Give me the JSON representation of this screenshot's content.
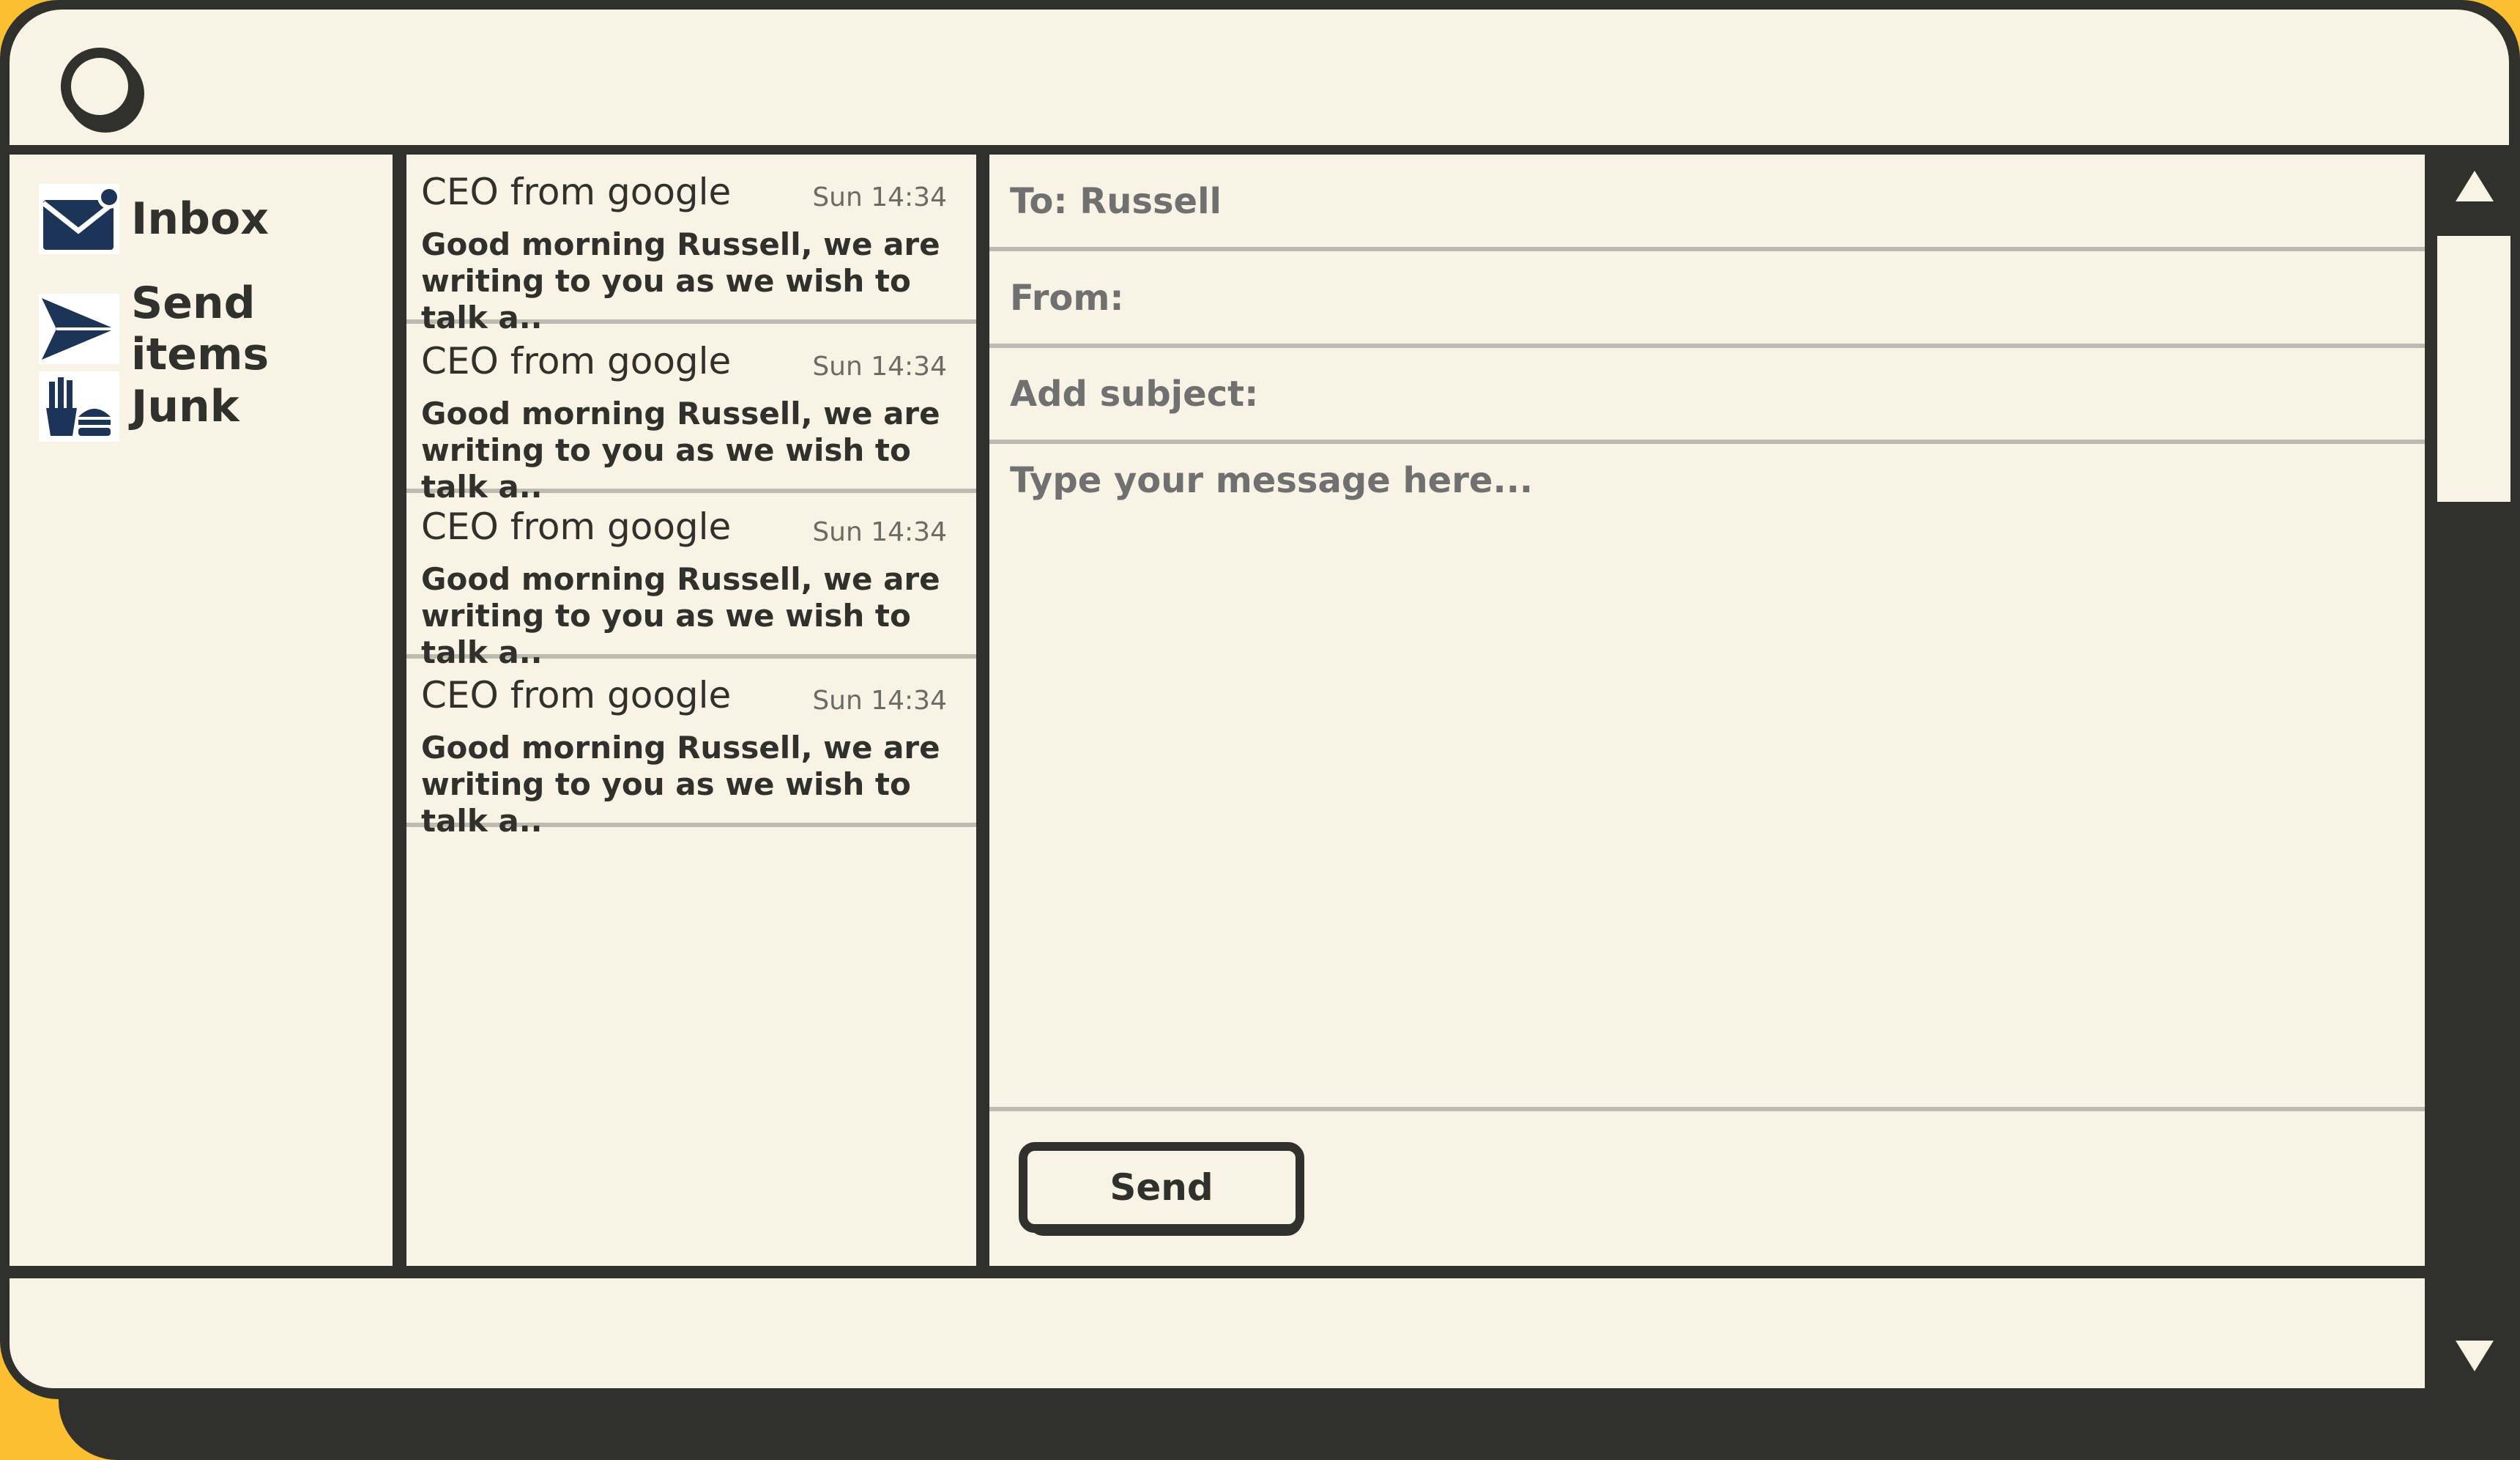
{
  "colors": {
    "accent_yellow": "#fcbf2f",
    "frame_dark": "#30302c",
    "panel_cream": "#f9f3e5",
    "icon_navy": "#1c3457",
    "divider_grey": "#bdbbb1",
    "muted_text": "#707070"
  },
  "header": {
    "logo_icon": "circle-logo-icon"
  },
  "sidebar": {
    "items": [
      {
        "label": "Inbox",
        "icon": "envelope-notification-icon"
      },
      {
        "label": "Send items",
        "icon": "paper-plane-icon"
      },
      {
        "label": "Junk",
        "icon": "junk-food-icon"
      }
    ]
  },
  "messages": [
    {
      "sender": "CEO from google",
      "time": "Sun 14:34",
      "preview_line1": "Good morning Russell, we are",
      "preview_line2": "writing to you as we wish to talk a.."
    },
    {
      "sender": "CEO from google",
      "time": "Sun 14:34",
      "preview_line1": "Good morning Russell, we are",
      "preview_line2": "writing to you as we wish to talk a.."
    },
    {
      "sender": "CEO from google",
      "time": "Sun 14:34",
      "preview_line1": "Good morning Russell, we are",
      "preview_line2": "writing to you as we wish to talk a.."
    },
    {
      "sender": "CEO from google",
      "time": "Sun 14:34",
      "preview_line1": "Good morning Russell, we are",
      "preview_line2": "writing to you as we wish to talk a.."
    }
  ],
  "compose": {
    "to_value": "To: Russell",
    "from_placeholder": "From:",
    "subject_placeholder": "Add subject:",
    "body_placeholder": "Type your message here...",
    "send_label": "Send"
  },
  "scrollbar": {
    "up_icon": "triangle-up-icon",
    "down_icon": "triangle-down-icon"
  }
}
